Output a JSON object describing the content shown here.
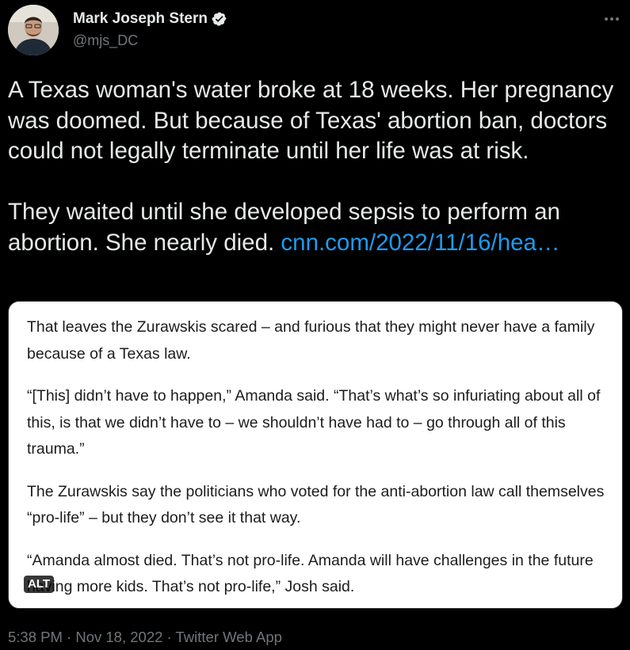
{
  "author": {
    "name": "Mark Joseph Stern",
    "handle": "@mjs_DC",
    "verified": true,
    "avatar_icon": "user-avatar"
  },
  "more_icon": "more-horizontal-icon",
  "tweet": {
    "paragraph_1": "A Texas woman's water broke at 18 weeks. Her pregnancy was doomed. But because of Texas' abortion ban, doctors could not legally terminate until her life was at risk.",
    "paragraph_2_text": "They waited until she developed sepsis to perform an abortion. She nearly died.",
    "link_text": "cnn.com/2022/11/16/hea…"
  },
  "media": {
    "alt_label": "ALT",
    "paragraphs": [
      "That leaves the Zurawskis scared – and furious that they might never have a family because of a Texas law.",
      "“[This] didn’t have to happen,” Amanda said. “That’s what’s so infuriating about all of this, is that we didn’t have to – we shouldn’t have had to – go through all of this trauma.”",
      "The Zurawskis say the politicians who voted for the anti-abortion law call themselves “pro-life” – but they don’t see it that way.",
      "“Amanda almost died. That’s not pro-life. Amanda will have challenges in the future having more kids. That’s not pro-life,” Josh said."
    ]
  },
  "meta": {
    "time": "5:38 PM",
    "date": "Nov 18, 2022",
    "source": "Twitter Web App",
    "separator": " · "
  },
  "colors": {
    "background": "#000000",
    "text": "#e7e9ea",
    "secondary": "#71767b",
    "link": "#1d9bf0"
  }
}
